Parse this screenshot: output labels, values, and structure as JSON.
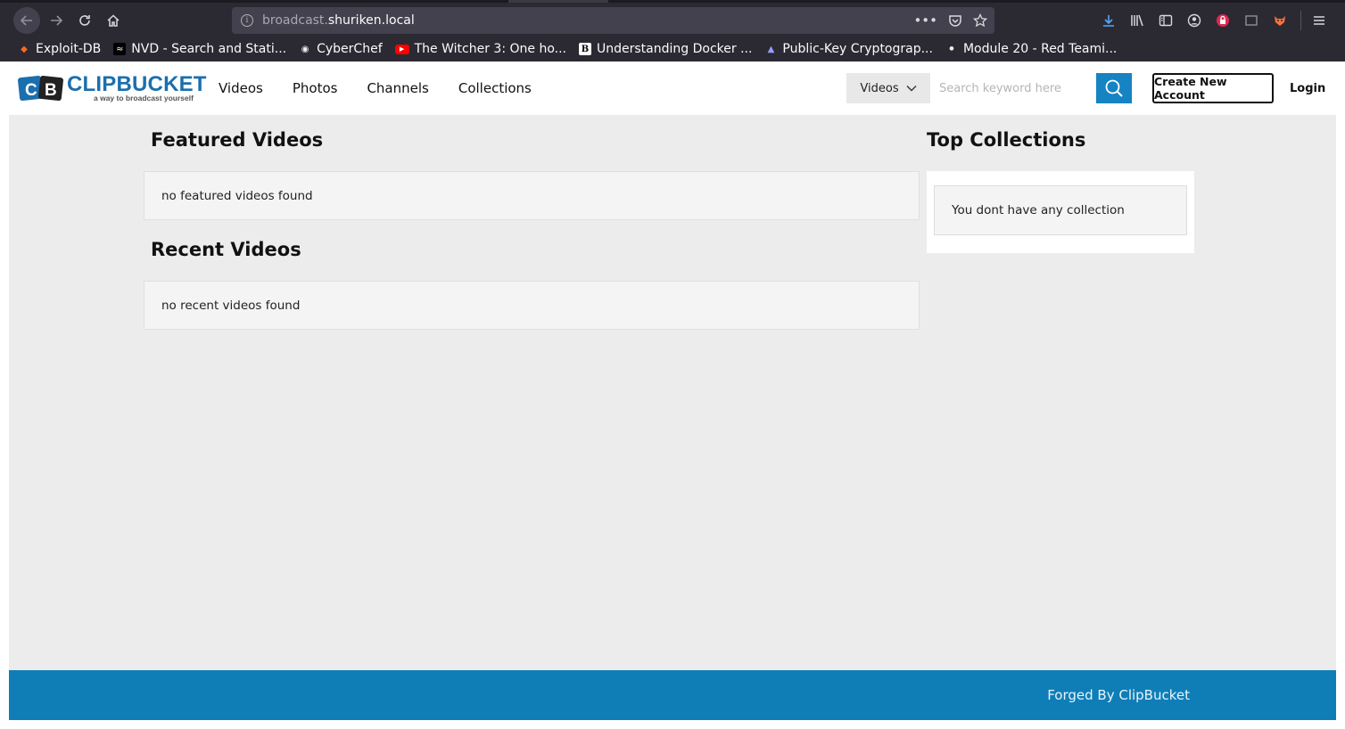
{
  "browser": {
    "url_prefix": "broadcast.",
    "url_domain": "shuriken.local",
    "bookmarks": [
      {
        "label": "Exploit-DB",
        "icon": "exploitdb-icon"
      },
      {
        "label": "NVD - Search and Stati...",
        "icon": "nvd-icon"
      },
      {
        "label": "CyberChef",
        "icon": "cyberchef-icon"
      },
      {
        "label": "The Witcher 3: One ho...",
        "icon": "youtube-icon"
      },
      {
        "label": "Understanding Docker ...",
        "icon": "docker-article-icon"
      },
      {
        "label": "Public-Key Cryptograp...",
        "icon": "crypto-icon"
      },
      {
        "label": "Module 20 - Red Teami...",
        "icon": "module-icon"
      }
    ]
  },
  "site": {
    "logo_word": "CLIPBUCKET",
    "logo_tagline": "a way to broadcast yourself",
    "nav": [
      "Videos",
      "Photos",
      "Channels",
      "Collections"
    ],
    "search": {
      "type_selected": "Videos",
      "placeholder": "Search keyword here"
    },
    "create_account": "Create New Account",
    "login": "Login"
  },
  "main": {
    "featured_title": "Featured Videos",
    "featured_empty": "no featured videos found",
    "recent_title": "Recent Videos",
    "recent_empty": "no recent videos found"
  },
  "sidebar": {
    "collections_title": "Top Collections",
    "collections_empty": "You dont have any collection"
  },
  "footer": {
    "text": "Forged By ClipBucket"
  },
  "colors": {
    "brand_blue": "#1683c2",
    "footer_blue": "#0f7eb7",
    "page_bg": "#ececec"
  }
}
